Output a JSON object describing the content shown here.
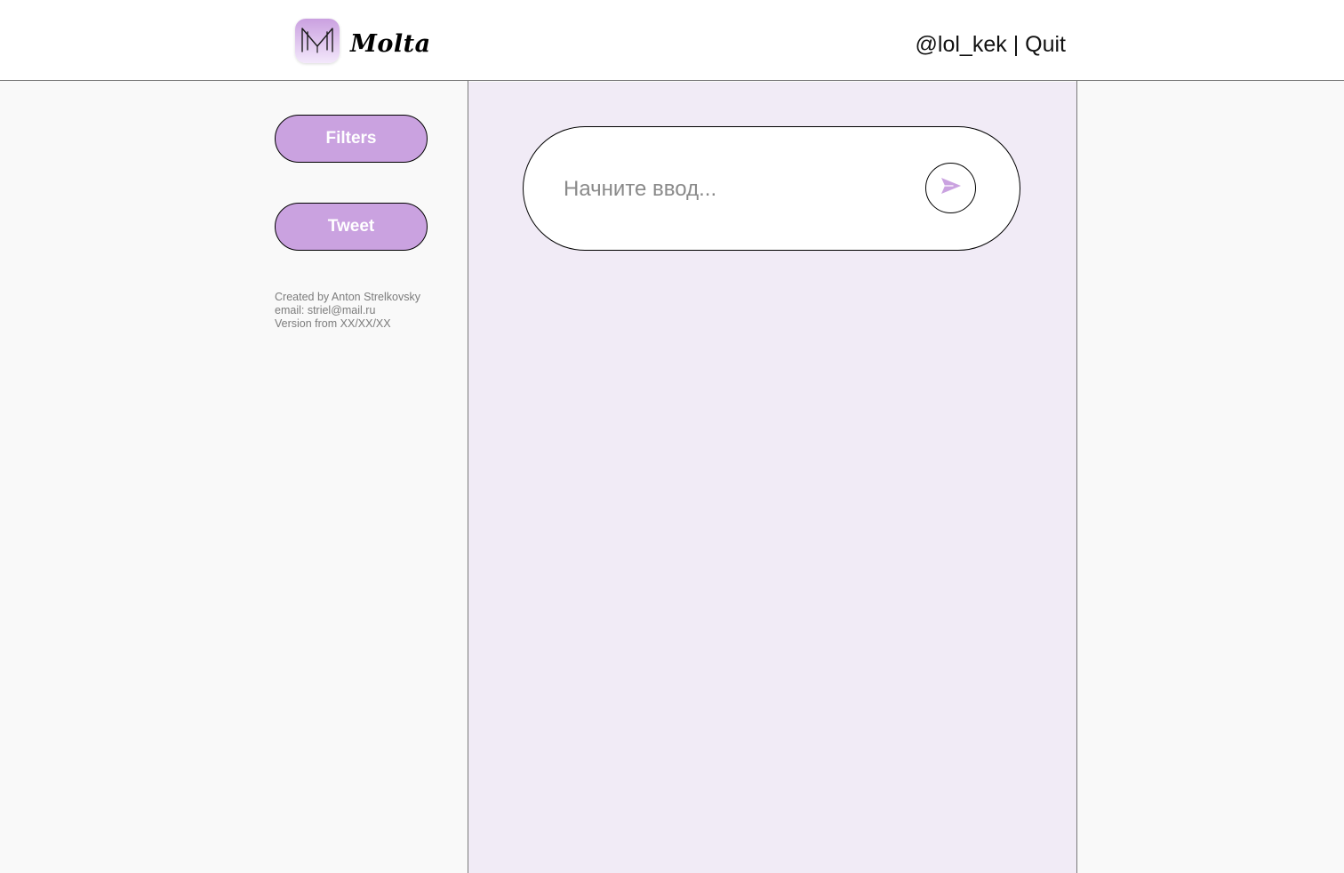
{
  "brand": {
    "name": "Molta",
    "logo_icon": "molta-logo-icon",
    "logo_letter": "M"
  },
  "account": {
    "username": "@lol_kek",
    "separator": "|",
    "quit_label": "Quit"
  },
  "sidebar": {
    "filters_label": "Filters",
    "tweet_label": "Tweet",
    "credits": [
      "Created by Anton Strelkovsky",
      "email: striel@mail.ru",
      "Version from XX/XX/XX"
    ]
  },
  "composer": {
    "placeholder": "Начните ввод...",
    "value": "",
    "send_icon": "send-icon"
  },
  "colors": {
    "accent": "#caa2e0",
    "feed_background": "#f1ebf6",
    "page_background": "#f9f9f9",
    "header_background": "#ffffff"
  }
}
